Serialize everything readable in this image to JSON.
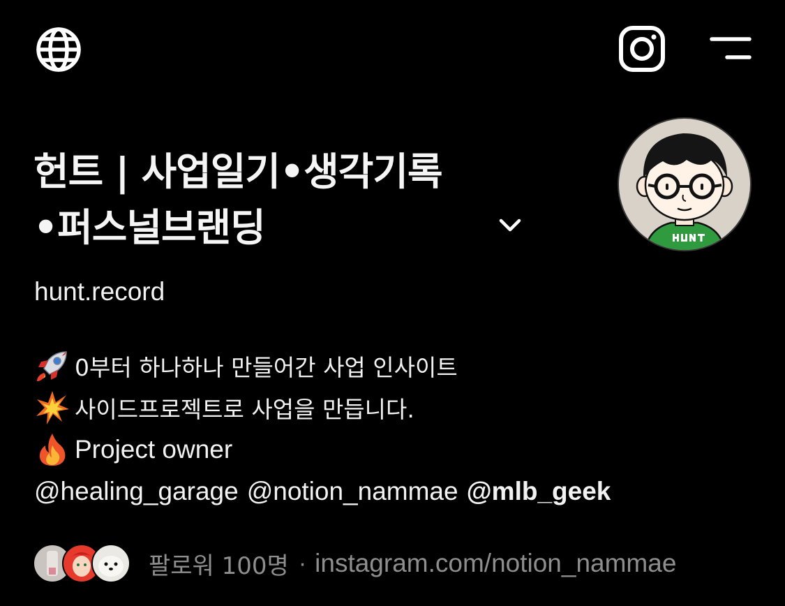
{
  "profile": {
    "name_line1": "헌트 | 사업일기•생각기록",
    "name_line2": "•퍼스널브랜딩",
    "username": "hunt.record"
  },
  "bio": {
    "line1": {
      "emoji": "rocket-emoji",
      "text": "0부터 하나하나 만들어간 사업 인사이트"
    },
    "line2": {
      "emoji": "collision-emoji",
      "text": "사이드프로젝트로 사업을 만듭니다."
    },
    "line3": {
      "emoji": "fire-emoji",
      "text": "Project owner"
    },
    "mentions": [
      "@healing_garage",
      "@notion_nammae",
      "@mlb_geek"
    ]
  },
  "followers": {
    "text": "팔로워 100명",
    "separator": "·",
    "link": "instagram.com/notion_nammae"
  },
  "icons": {
    "globe": "globe-icon",
    "instagram": "instagram-icon",
    "menu": "menu-icon",
    "chevron": "chevron-down-icon"
  },
  "colors": {
    "background": "#000000",
    "text": "#f2f2f2",
    "muted": "#8e8e8e"
  }
}
